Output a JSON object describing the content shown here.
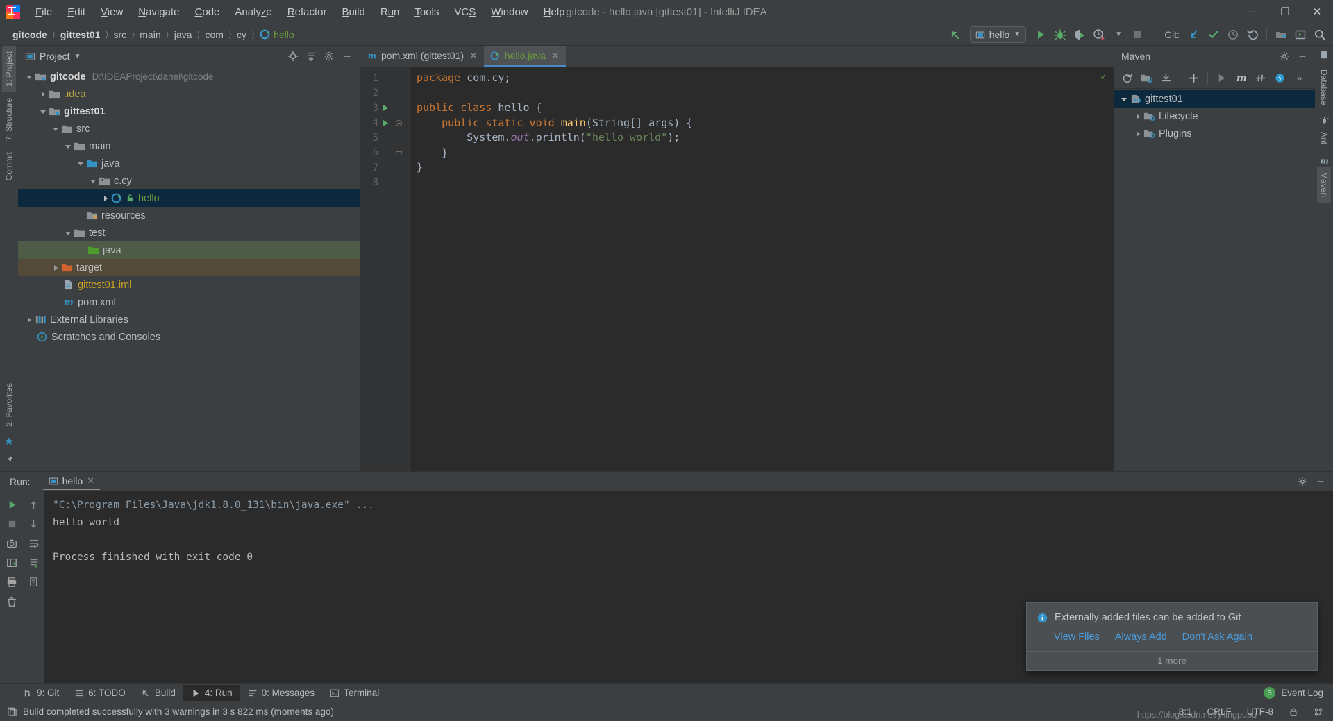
{
  "window": {
    "title": "gitcode - hello.java [gittest01] - IntelliJ IDEA",
    "minimize": "─",
    "maximize": "❐",
    "close": "✕"
  },
  "menu": [
    {
      "label": "File",
      "mnemonic": "F"
    },
    {
      "label": "Edit",
      "mnemonic": "E"
    },
    {
      "label": "View",
      "mnemonic": "V"
    },
    {
      "label": "Navigate",
      "mnemonic": "N"
    },
    {
      "label": "Code",
      "mnemonic": "C"
    },
    {
      "label": "Analyze",
      "mnemonic": "z"
    },
    {
      "label": "Refactor",
      "mnemonic": "R"
    },
    {
      "label": "Build",
      "mnemonic": "B"
    },
    {
      "label": "Run",
      "mnemonic": "u"
    },
    {
      "label": "Tools",
      "mnemonic": "T"
    },
    {
      "label": "VCS",
      "mnemonic": "S"
    },
    {
      "label": "Window",
      "mnemonic": "W"
    },
    {
      "label": "Help",
      "mnemonic": "H"
    }
  ],
  "breadcrumbs": [
    {
      "label": "gitcode",
      "style": "bold"
    },
    {
      "label": "gittest01",
      "style": "bold"
    },
    {
      "label": "src",
      "style": "normal"
    },
    {
      "label": "main",
      "style": "normal"
    },
    {
      "label": "java",
      "style": "normal"
    },
    {
      "label": "com",
      "style": "normal"
    },
    {
      "label": "cy",
      "style": "normal"
    },
    {
      "label": "hello",
      "style": "green",
      "icon": "class-icon"
    }
  ],
  "toolbar": {
    "back_icon": "back-arrow-icon",
    "run_config": "hello",
    "run_icon": "run-icon",
    "debug_icon": "debug-icon",
    "coverage_icon": "run-with-coverage-icon",
    "profiler_icon": "profiler-icon",
    "stop_icon": "stop-icon",
    "git_label": "Git:",
    "update_icon": "update-project-icon",
    "commit_icon": "commit-icon",
    "history_icon": "history-icon",
    "rollback_icon": "rollback-icon",
    "project_structure_icon": "project-structure-icon",
    "terminal_icon": "terminal-icon",
    "search_icon": "search-everywhere-icon"
  },
  "left_rail": [
    {
      "label": "1: Project",
      "active": true
    },
    {
      "label": "7: Structure",
      "active": false
    },
    {
      "label": "Commit",
      "active": false
    },
    {
      "label": "2: Favorites",
      "active": false
    }
  ],
  "right_rail": [
    {
      "label": "Database"
    },
    {
      "label": "Ant"
    },
    {
      "label": "Maven"
    }
  ],
  "project_panel": {
    "title": "Project",
    "chevron": "▾",
    "actions": [
      "locate-icon",
      "collapse-all-icon",
      "settings-icon",
      "hide-icon"
    ],
    "tree": [
      {
        "label": "gitcode",
        "path": "D:\\IDEAProject\\danei\\gitcode",
        "indent": 0,
        "arrow": "open",
        "icon": "module-folder-icon",
        "style": "bold"
      },
      {
        "label": ".idea",
        "path": "",
        "indent": 1,
        "arrow": "closed",
        "icon": "folder-icon",
        "style": "yellow"
      },
      {
        "label": "gittest01",
        "path": "",
        "indent": 1,
        "arrow": "open",
        "icon": "module-folder-icon",
        "style": "bold"
      },
      {
        "label": "src",
        "path": "",
        "indent": 2,
        "arrow": "open",
        "icon": "folder-icon",
        "style": "normal"
      },
      {
        "label": "main",
        "path": "",
        "indent": 3,
        "arrow": "open",
        "icon": "folder-icon",
        "style": "normal"
      },
      {
        "label": "java",
        "path": "",
        "indent": 4,
        "arrow": "open",
        "icon": "source-root-icon",
        "style": "normal"
      },
      {
        "label": "c.cy",
        "path": "",
        "indent": 5,
        "arrow": "open",
        "icon": "package-icon",
        "style": "normal"
      },
      {
        "label": "hello",
        "path": "",
        "indent": 6,
        "arrow": "closed",
        "icon": "java-class-icon",
        "style": "green",
        "row": "selected"
      },
      {
        "label": "resources",
        "path": "",
        "indent": 4,
        "arrow": "none",
        "icon": "resource-root-icon",
        "style": "normal"
      },
      {
        "label": "test",
        "path": "",
        "indent": 3,
        "arrow": "open",
        "icon": "folder-icon",
        "style": "normal"
      },
      {
        "label": "java",
        "path": "",
        "indent": 4,
        "arrow": "none",
        "icon": "test-source-root-icon",
        "style": "normal",
        "row": "green"
      },
      {
        "label": "target",
        "path": "",
        "indent": 2,
        "arrow": "closed",
        "icon": "excluded-folder-icon",
        "style": "normal",
        "row": "brown"
      },
      {
        "label": "gittest01.iml",
        "path": "",
        "indent": 3,
        "arrow": "none",
        "icon": "iml-file-icon",
        "style": "orange"
      },
      {
        "label": "pom.xml",
        "path": "",
        "indent": 3,
        "arrow": "none",
        "icon": "maven-file-icon",
        "style": "normal"
      },
      {
        "label": "External Libraries",
        "path": "",
        "indent": 0,
        "arrow": "closed",
        "icon": "libraries-icon",
        "style": "normal"
      },
      {
        "label": "Scratches and Consoles",
        "path": "",
        "indent": 0,
        "arrow": "none",
        "icon": "scratches-icon",
        "style": "normal"
      }
    ]
  },
  "editor": {
    "tabs": [
      {
        "label": "pom.xml (gittest01)",
        "icon": "maven-file-icon",
        "active": false,
        "close": "✕"
      },
      {
        "label": "hello.java",
        "icon": "java-class-icon",
        "active": true,
        "close": "✕"
      }
    ],
    "inspection_status": "✓",
    "lines": [
      {
        "n": "1",
        "runmark": false,
        "fold": "none"
      },
      {
        "n": "2",
        "runmark": false,
        "fold": "none"
      },
      {
        "n": "3",
        "runmark": true,
        "fold": "none"
      },
      {
        "n": "4",
        "runmark": true,
        "fold": "open"
      },
      {
        "n": "5",
        "runmark": false,
        "fold": "bar"
      },
      {
        "n": "6",
        "runmark": false,
        "fold": "close"
      },
      {
        "n": "7",
        "runmark": false,
        "fold": "none"
      },
      {
        "n": "8",
        "runmark": false,
        "fold": "none"
      }
    ],
    "code": [
      "package com.cy;",
      "",
      "public class hello {",
      "    public static void main(String[] args) {",
      "        System.out.println(\"hello world\");",
      "    }",
      "}",
      ""
    ]
  },
  "maven_panel": {
    "title": "Maven",
    "settings_icon": "settings-icon",
    "hide_icon": "hide-icon",
    "toolbar": [
      "reimport-icon",
      "generate-sources-icon",
      "download-sources-icon",
      "add-icon",
      "run-icon",
      "execute-goal-icon",
      "toggle-skip-tests-icon",
      "toggle-offline-icon",
      "more-icon"
    ],
    "tree": [
      {
        "label": "gittest01",
        "indent": 0,
        "arrow": "open",
        "icon": "maven-project-icon",
        "selected": true
      },
      {
        "label": "Lifecycle",
        "indent": 1,
        "arrow": "closed",
        "icon": "maven-folder-icon",
        "selected": false
      },
      {
        "label": "Plugins",
        "indent": 1,
        "arrow": "closed",
        "icon": "maven-folder-icon",
        "selected": false
      }
    ]
  },
  "run_panel": {
    "label": "Run:",
    "tab": "hello",
    "tab_icon": "run-config-icon",
    "tab_close": "✕",
    "settings_icon": "settings-icon",
    "hide_icon": "hide-icon",
    "rail_primary": [
      "rerun-icon",
      "stop-icon",
      "screenshot-icon",
      "restore-layout-icon",
      "print-icon",
      "trash-icon"
    ],
    "rail_secondary": [
      "scroll-up-icon",
      "scroll-down-icon",
      "soft-wrap-icon",
      "scroll-to-end-icon",
      "export-icon"
    ],
    "console": [
      {
        "text": "\"C:\\Program Files\\Java\\jdk1.8.0_131\\bin\\java.exe\" ...",
        "style": "command"
      },
      {
        "text": "hello world",
        "style": "plain"
      },
      {
        "text": "",
        "style": "plain"
      },
      {
        "text": "Process finished with exit code 0",
        "style": "plain"
      }
    ]
  },
  "notification": {
    "icon": "info-icon",
    "message": "Externally added files can be added to Git",
    "links": [
      "View Files",
      "Always Add",
      "Don't Ask Again"
    ],
    "more": "1 more"
  },
  "toolwindow_bar": [
    {
      "label": "9: Git",
      "mnemonic": "9",
      "icon": "git-icon",
      "active": false
    },
    {
      "label": "6: TODO",
      "mnemonic": "6",
      "icon": "todo-icon",
      "active": false
    },
    {
      "label": "Build",
      "mnemonic": "",
      "icon": "build-icon",
      "active": false
    },
    {
      "label": "4: Run",
      "mnemonic": "4",
      "icon": "run-icon",
      "active": true
    },
    {
      "label": "0: Messages",
      "mnemonic": "0",
      "icon": "messages-icon",
      "active": false
    },
    {
      "label": "Terminal",
      "mnemonic": "",
      "icon": "terminal-icon",
      "active": false
    }
  ],
  "event_log": {
    "count": "3",
    "label": "Event Log"
  },
  "status_bar": {
    "build_message": "Build completed successfully with 3 warnings in 3 s 822 ms (moments ago)",
    "build_icon": "build-status-icon",
    "caret": "8:1",
    "line_separator": "CRLF",
    "encoding": "UTF-8",
    "watermark": "https://blog.csdn.net/yilingpupu",
    "lock_icon": "lock-icon",
    "branch_icon": "git-branch-icon"
  },
  "colors": {
    "accent": "#4a88c7",
    "green": "#499c54",
    "selection": "#0d293e",
    "link": "#4a9bdc",
    "panel": "#3c3f41",
    "editor": "#2b2b2b"
  }
}
